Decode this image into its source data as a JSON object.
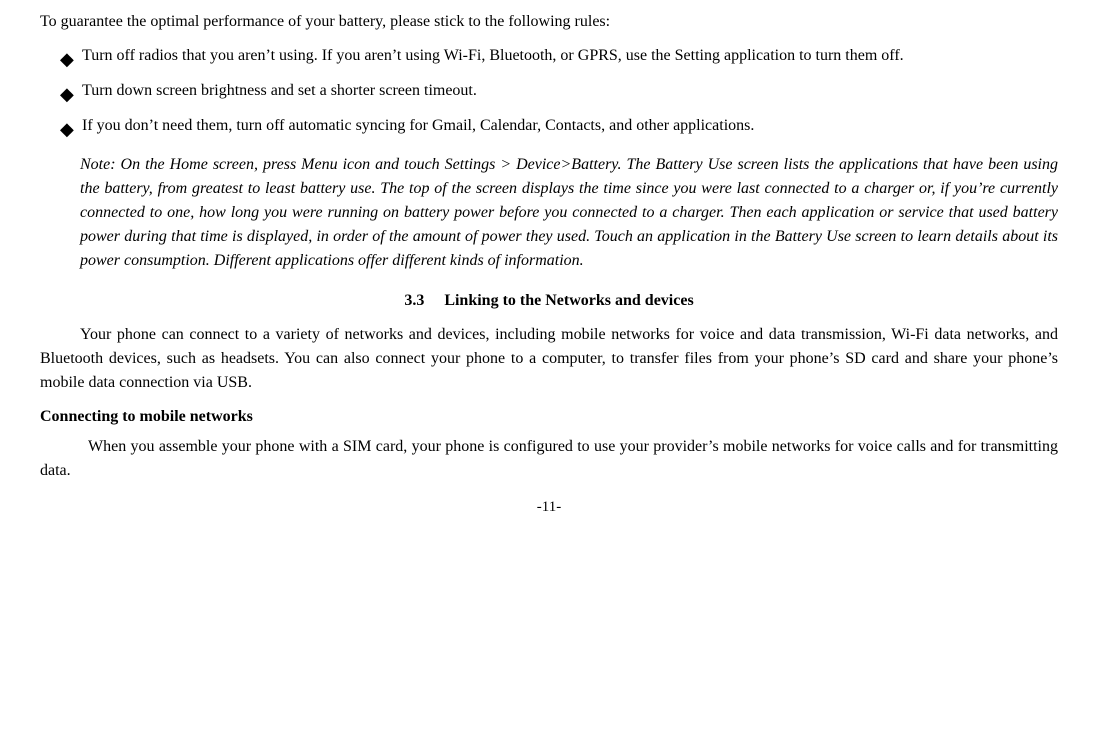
{
  "intro": {
    "line": "To guarantee the optimal performance of your battery, please stick to the following rules:"
  },
  "bullets": [
    {
      "text": "Turn off radios that you aren’t using. If you aren’t using Wi-Fi, Bluetooth, or GPRS, use the Setting application to turn them off."
    },
    {
      "text": "Turn down screen brightness and set a shorter screen timeout."
    },
    {
      "text": "If  you  don’t  need  them,  turn  off  automatic  syncing  for  Gmail,  Calendar,  Contacts,  and  other applications."
    }
  ],
  "note": {
    "text": "Note: On the Home screen, press Menu icon and touch Settings > Device>Battery. The Battery Use screen lists the applications that have been using the battery, from greatest to least battery use. The top of the screen displays the time since you were last connected to a charger or, if you’re currently connected to one, how long you were running on battery power before you connected to a charger. Then each application or service that used battery power during that time is displayed, in order of the amount of power they used. Touch an application in the Battery Use screen to learn details about its power consumption. Different applications offer different kinds of information."
  },
  "section": {
    "number": "3.3",
    "title": "Linking to the Networks and devices"
  },
  "section_paragraph": "Your phone can connect to a variety of networks and devices, including mobile networks for voice and data transmission, Wi-Fi data networks, and Bluetooth devices, such as headsets. You can also connect your phone  to  a  computer,  to  transfer  files  from  your  phone’s  SD  card  and  share  your  phone’s  mobile  data connection via USB.",
  "subsection": {
    "title": "Connecting to mobile networks"
  },
  "subsection_paragraph": "When  you  assemble  your  phone  with  a  SIM  card,  your  phone  is  configured  to  use  your  provider’s mobile networks for voice calls and for transmitting data.",
  "page_number": "-11-"
}
